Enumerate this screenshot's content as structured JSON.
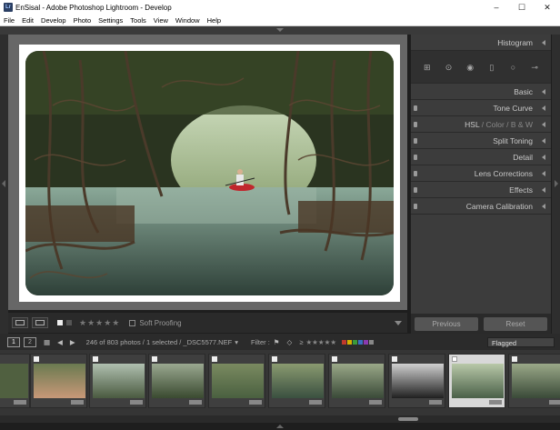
{
  "window": {
    "title": "EnSisal - Adobe Photoshop Lightroom - Develop",
    "controls": [
      "–",
      "☐",
      "✕"
    ]
  },
  "menu": [
    "File",
    "Edit",
    "Develop",
    "Photo",
    "Settings",
    "Tools",
    "View",
    "Window",
    "Help"
  ],
  "right_panel": {
    "histogram": "Histogram",
    "basic": "Basic",
    "tone_curve": "Tone Curve",
    "hsl": {
      "hsl": "HSL",
      "sep1": " / ",
      "color": "Color",
      "sep2": " / ",
      "bw": "B & W"
    },
    "split_toning": "Split Toning",
    "detail": "Detail",
    "lens": "Lens Corrections",
    "effects": "Effects",
    "camera": "Camera Calibration",
    "previous": "Previous",
    "reset": "Reset"
  },
  "toolbar": {
    "stars": "★★★★★",
    "soft_proofing": "Soft Proofing"
  },
  "filmbar": {
    "page1": "1",
    "page2": "2",
    "info": "246 of 803 photos / 1 selected / _DSC5577.NEF",
    "filter_label": "Filter :",
    "rating_op": "≥",
    "stars": "★★★★★",
    "flagged": "Flagged"
  },
  "colors": {
    "accent_red": "#c0272d",
    "label_swatches": [
      "#c0392b",
      "#d4b000",
      "#3a9a3a",
      "#3a6fc0",
      "#8a3ab0",
      "#888888"
    ]
  }
}
